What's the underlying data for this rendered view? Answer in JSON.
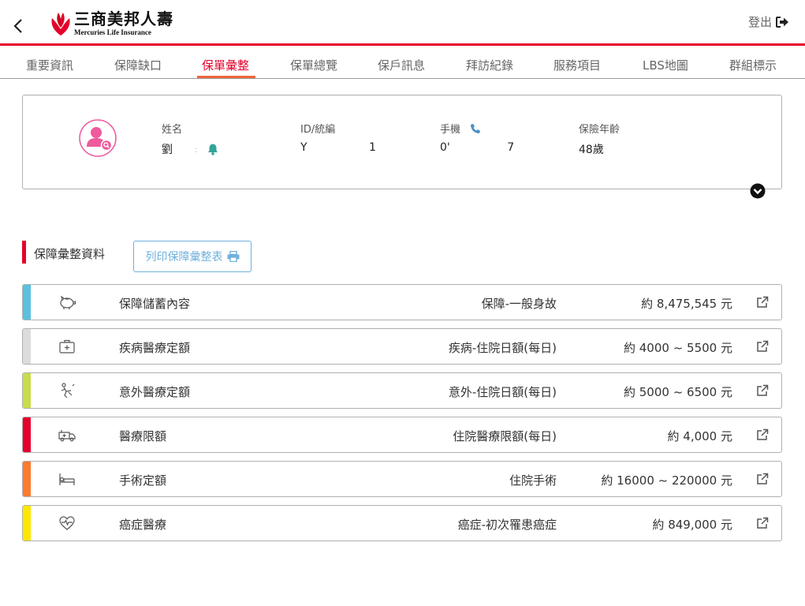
{
  "header": {
    "logo_cn": "三商美邦人壽",
    "logo_en": "Mercuries Life Insurance",
    "logout_label": "登出",
    "back_icon": "chevron-left-icon",
    "logout_icon": "sign-out-icon"
  },
  "tabs": [
    {
      "label": "重要資訊",
      "active": false
    },
    {
      "label": "保障缺口",
      "active": false
    },
    {
      "label": "保單彙整",
      "active": true
    },
    {
      "label": "保單總覽",
      "active": false
    },
    {
      "label": "保戶訊息",
      "active": false
    },
    {
      "label": "拜訪紀錄",
      "active": false
    },
    {
      "label": "服務項目",
      "active": false
    },
    {
      "label": "LBS地圖",
      "active": false
    },
    {
      "label": "群組標示",
      "active": false
    }
  ],
  "profile": {
    "avatar_icon": "user-search-icon",
    "name_label": "姓名",
    "name_value": "劉",
    "name_separator": ":",
    "id_label": "ID/統編",
    "id_value_start": "Y",
    "id_value_end": "1",
    "phone_label": "手機",
    "phone_value_start": "0'",
    "phone_value_end": "7",
    "age_label": "保險年齡",
    "age_value": "48歲"
  },
  "section": {
    "title": "保障彙整資料",
    "print_label": "列印保障彙整表"
  },
  "colors": {
    "brand_red": "#e4002b",
    "tab_underline": "#f0663e",
    "print_blue": "#6fb1dc",
    "bell_teal": "#35a39a",
    "phone_blue": "#4a90c8",
    "avatar_pink": "#ee5a9c"
  },
  "rows": [
    {
      "name": "保障儲蓄內容",
      "type": "保障-一般身故",
      "amount": "約 8,475,545 元",
      "color": "#5bc0de",
      "icon": "piggy-bank-icon"
    },
    {
      "name": "疾病醫療定額",
      "type": "疾病-住院日額(每日)",
      "amount": "約 4000 ~ 5500 元",
      "color": "#dcdcdc",
      "icon": "medical-kit-icon"
    },
    {
      "name": "意外醫療定額",
      "type": "意外-住院日額(每日)",
      "amount": "約 5000 ~ 6500 元",
      "color": "#c9dc4a",
      "icon": "falling-person-icon"
    },
    {
      "name": "醫療限額",
      "type": "住院醫療限額(每日)",
      "amount": "約 4,000 元",
      "color": "#e4002b",
      "icon": "ambulance-icon"
    },
    {
      "name": "手術定額",
      "type": "住院手術",
      "amount": "約 16000 ~ 220000 元",
      "color": "#ff7a2e",
      "icon": "hospital-bed-icon"
    },
    {
      "name": "癌症醫療",
      "type": "癌症-初次罹患癌症",
      "amount": "約 849,000 元",
      "color": "#ffe600",
      "icon": "heartbeat-icon"
    }
  ]
}
